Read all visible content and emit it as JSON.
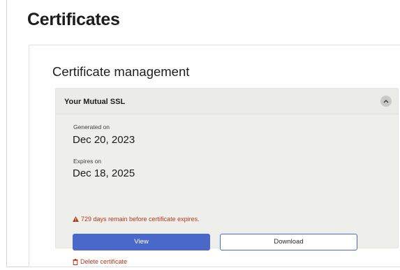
{
  "page": {
    "title": "Certificates"
  },
  "section": {
    "title": "Certificate management"
  },
  "certificate": {
    "name": "Your Mutual SSL",
    "generated_label": "Generated on",
    "generated_value": "Dec 20, 2023",
    "expires_label": "Expires on",
    "expires_value": "Dec 18, 2025",
    "warning": "729 days remain before certificate expires.",
    "view_label": "View",
    "download_label": "Download",
    "delete_label": "Delete certificate"
  },
  "colors": {
    "primary": "#4a68c9",
    "warning": "#b4391f",
    "card_bg": "#eeeeeb"
  },
  "icons": [
    "chevron-up-icon",
    "warning-icon",
    "trash-icon"
  ]
}
